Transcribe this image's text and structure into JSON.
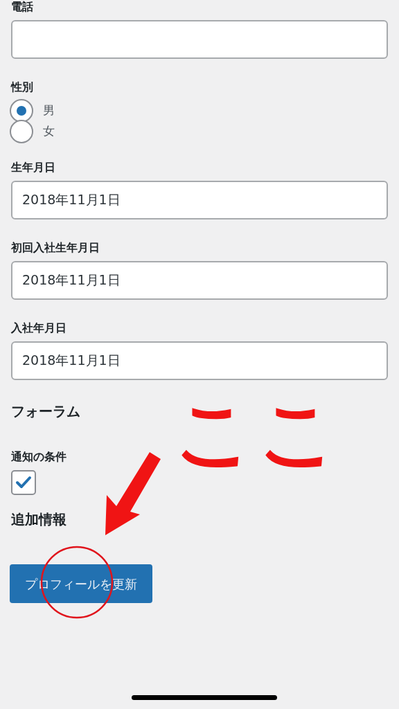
{
  "fields": [
    {
      "kind": "text",
      "label": "電話"
    },
    {
      "kind": "radio",
      "label": "性別",
      "options": [
        {
          "label": "男",
          "selected": true
        },
        {
          "label": "女",
          "selected": false
        }
      ]
    },
    {
      "kind": "text",
      "label": "生年月日",
      "value": "2018年11月1日"
    },
    {
      "kind": "text",
      "label": "初回入社生年月日",
      "value": "2018年11月1日"
    },
    {
      "kind": "text",
      "label": "入社年月日",
      "value": "2018年11月1日"
    },
    {
      "kind": "heading",
      "label": "フォーラム"
    },
    {
      "kind": "checkbox",
      "label": "通知の条件",
      "checked": true
    },
    {
      "kind": "heading",
      "label": "追加情報"
    }
  ],
  "submit_button": "プロフィールを更新",
  "annotation": {
    "text": "ここ"
  }
}
